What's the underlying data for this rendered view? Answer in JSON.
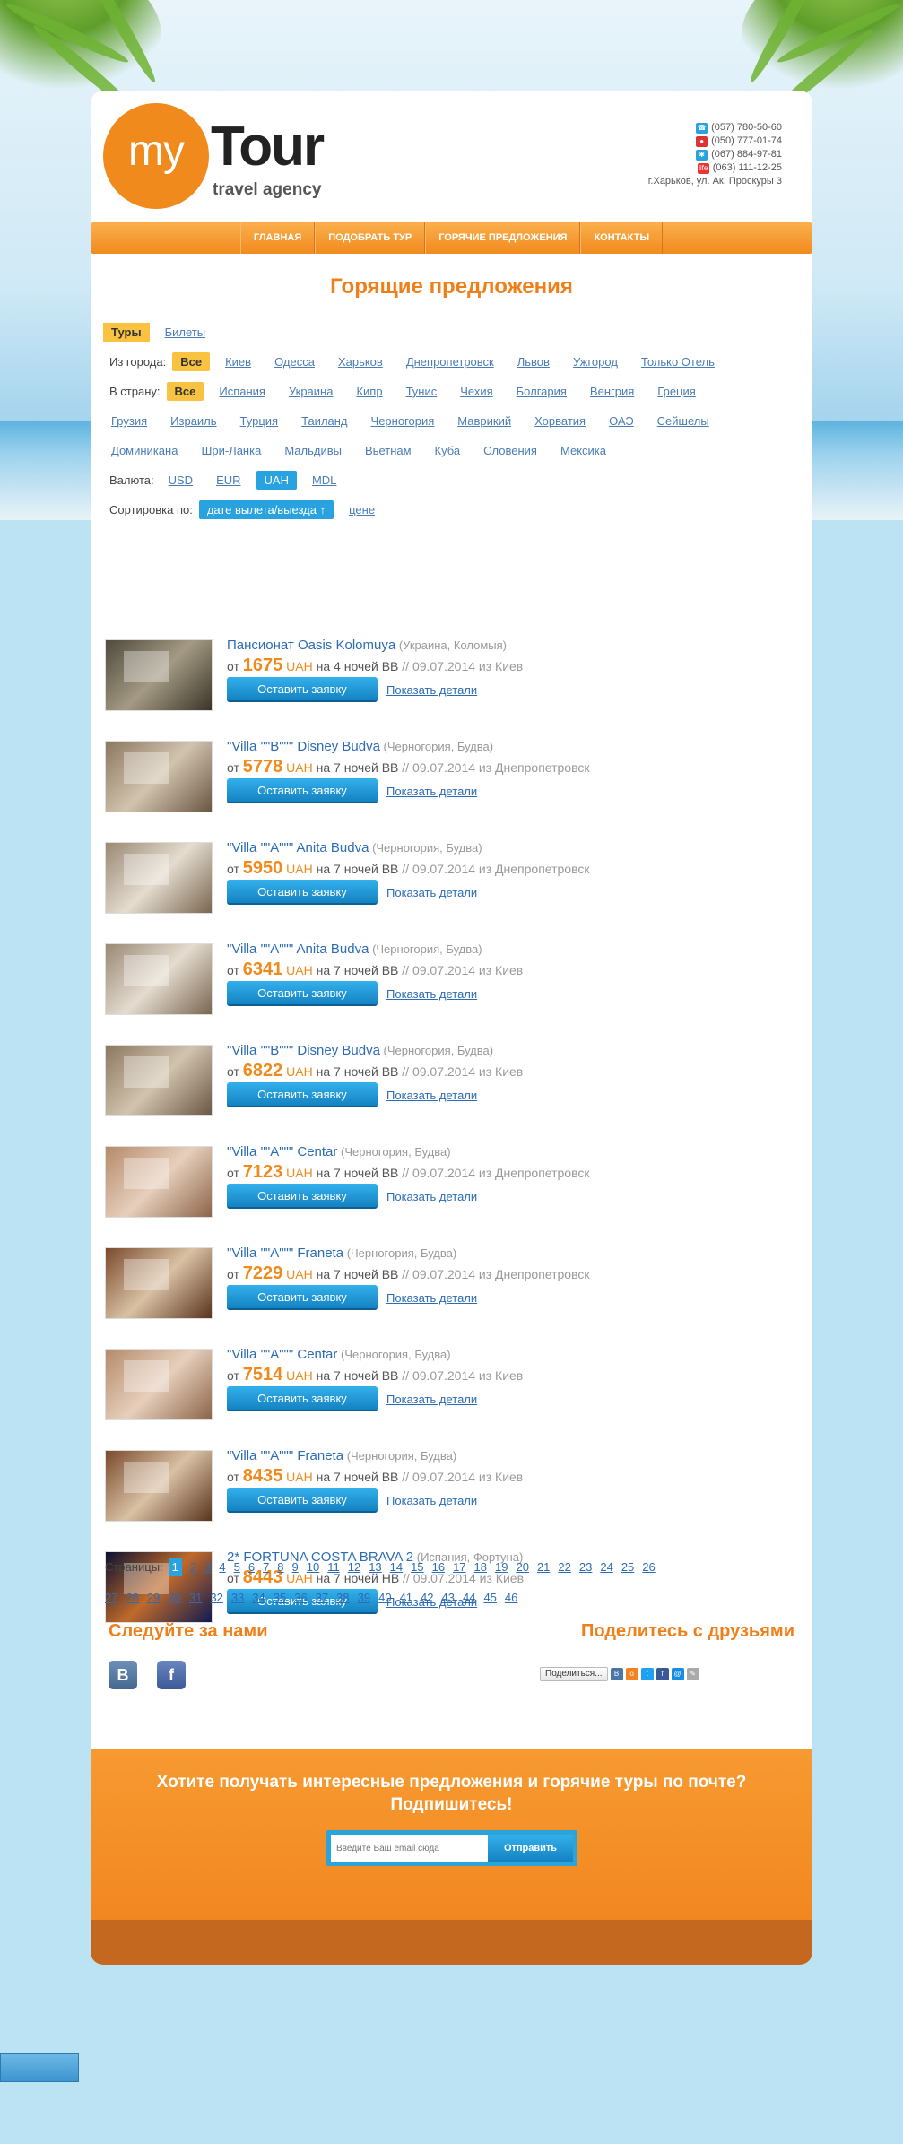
{
  "brand": {
    "logo_my": "my",
    "logo_tour": "Tour",
    "logo_sub": "travel agency"
  },
  "contacts": {
    "phones": [
      "(057) 780-50-60",
      "(050) 777-01-74",
      "(067) 884-97-81",
      "(063) 111-12-25"
    ],
    "address": "г.Харьков, ул. Ак. Проскуры 3"
  },
  "menu": [
    "ГЛАВНАЯ",
    "ПОДОБРАТЬ ТУР",
    "ГОРЯЧИЕ ПРЕДЛОЖЕНИЯ",
    "КОНТАКТЫ"
  ],
  "page_title": "Горящие предложения",
  "filters": {
    "tabs": [
      "Туры",
      "Билеты"
    ],
    "city_label": "Из города:",
    "cities": [
      "Все",
      "Киев",
      "Одесса",
      "Харьков",
      "Днепропетровск",
      "Львов",
      "Ужгород",
      "Только Отель"
    ],
    "country_label": "В страну:",
    "countries_row1": [
      "Все",
      "Испания",
      "Украина",
      "Кипр",
      "Тунис",
      "Чехия",
      "Болгария",
      "Венгрия",
      "Греция"
    ],
    "countries_row2": [
      "Грузия",
      "Израиль",
      "Турция",
      "Таиланд",
      "Черногория",
      "Маврикий",
      "Хорватия",
      "ОАЭ",
      "Сейшелы"
    ],
    "countries_row3": [
      "Доминикана",
      "Шри-Ланка",
      "Мальдивы",
      "Вьетнам",
      "Куба",
      "Словения",
      "Мексика"
    ],
    "currency_label": "Валюта:",
    "currencies": [
      "USD",
      "EUR",
      "UAH",
      "MDL"
    ],
    "sort_label": "Сортировка по:",
    "sort_options": [
      "дате вылета/выезда ↑",
      "цене"
    ]
  },
  "offers": [
    {
      "name": "Пансионат Oasis Kolomuya",
      "loc": "(Украина, Коломыя)",
      "from": "от",
      "price": "1675",
      "cur": "UAH",
      "nights": "на 4 ночей BB",
      "date": "// 09.07.2014 из Киев"
    },
    {
      "name": "\"Villa \"\"B\"\"\" Disney Budva",
      "loc": "(Черногория, Будва)",
      "from": "от",
      "price": "5778",
      "cur": "UAH",
      "nights": "на 7 ночей BB",
      "date": "// 09.07.2014 из Днепропетровск"
    },
    {
      "name": "\"Villa \"\"A\"\"\" Anita Budva",
      "loc": "(Черногория, Будва)",
      "from": "от",
      "price": "5950",
      "cur": "UAH",
      "nights": "на 7 ночей BB",
      "date": "// 09.07.2014 из Днепропетровск"
    },
    {
      "name": "\"Villa \"\"A\"\"\" Anita Budva",
      "loc": "(Черногория, Будва)",
      "from": "от",
      "price": "6341",
      "cur": "UAH",
      "nights": "на 7 ночей BB",
      "date": "// 09.07.2014 из Киев"
    },
    {
      "name": "\"Villa \"\"B\"\"\" Disney Budva",
      "loc": "(Черногория, Будва)",
      "from": "от",
      "price": "6822",
      "cur": "UAH",
      "nights": "на 7 ночей BB",
      "date": "// 09.07.2014 из Киев"
    },
    {
      "name": "\"Villa \"\"A\"\"\" Centar",
      "loc": "(Черногория, Будва)",
      "from": "от",
      "price": "7123",
      "cur": "UAH",
      "nights": "на 7 ночей BB",
      "date": "// 09.07.2014 из Днепропетровск"
    },
    {
      "name": "\"Villa \"\"A\"\"\" Franeta",
      "loc": "(Черногория, Будва)",
      "from": "от",
      "price": "7229",
      "cur": "UAH",
      "nights": "на 7 ночей BB",
      "date": "// 09.07.2014 из Днепропетровск"
    },
    {
      "name": "\"Villa \"\"A\"\"\" Centar",
      "loc": "(Черногория, Будва)",
      "from": "от",
      "price": "7514",
      "cur": "UAH",
      "nights": "на 7 ночей BB",
      "date": "// 09.07.2014 из Киев"
    },
    {
      "name": "\"Villa \"\"A\"\"\" Franeta",
      "loc": "(Черногория, Будва)",
      "from": "от",
      "price": "8435",
      "cur": "UAH",
      "nights": "на 7 ночей BB",
      "date": "// 09.07.2014 из Киев"
    },
    {
      "name": "2* FORTUNA COSTA BRAVA 2",
      "loc": "(Испания,  Фортуна)",
      "from": "от",
      "price": "8443",
      "cur": "UAH",
      "nights": "на 7 ночей HB",
      "date": "// 09.07.2014 из Киев"
    }
  ],
  "offer_button": "Оставить заявку",
  "offer_details": "Показать детали",
  "pager": {
    "label": "Страницы:",
    "current": "1",
    "pages_row1": [
      "2",
      "3",
      "4",
      "5",
      "6",
      "7",
      "8",
      "9",
      "10",
      "11",
      "12",
      "13",
      "14",
      "15",
      "16",
      "17",
      "18",
      "19",
      "20",
      "21",
      "22",
      "23",
      "24",
      "25",
      "26"
    ],
    "pages_row2": [
      "27",
      "28",
      "29",
      "30",
      "31",
      "32",
      "33",
      "34",
      "35",
      "36",
      "37",
      "38",
      "39",
      "40",
      "41",
      "42",
      "43",
      "44",
      "45",
      "46"
    ]
  },
  "follow_title": "Следуйте за нами",
  "share_title": "Поделитесь с друзьями",
  "social": {
    "vk": "B",
    "fb": "f"
  },
  "share_button": "Поделиться...",
  "subscribe": {
    "text_line1": "Хотите получать интересные предложения и горячие туры по почте?",
    "text_line2": "Подпишитесь!",
    "placeholder": "Введите Ваш email сюда",
    "button": "Отправить"
  },
  "colors": {
    "accent": "#f08a1c",
    "link": "#2c6cb5",
    "button": "#1f98d8",
    "selected": "#f9c341"
  }
}
